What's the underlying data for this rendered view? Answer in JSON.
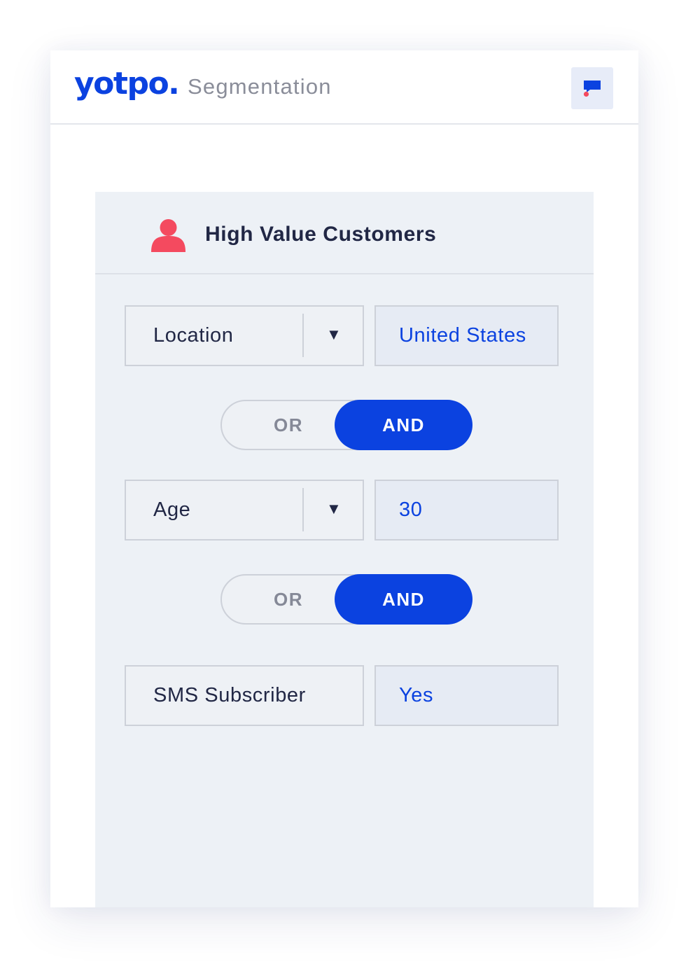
{
  "header": {
    "logo": "yotpo.",
    "title": "Segmentation",
    "chat_icon": "chat-bubble-icon"
  },
  "segment": {
    "icon": "user-icon",
    "name": "High Value Customers"
  },
  "conditions": [
    {
      "field": "Location",
      "value": "United States",
      "has_dropdown": true
    },
    {
      "field": "Age",
      "value": "30",
      "has_dropdown": true
    },
    {
      "field": "SMS Subscriber",
      "value": "Yes",
      "has_dropdown": false
    }
  ],
  "operators": [
    {
      "or_label": "OR",
      "and_label": "AND",
      "selected": "AND"
    },
    {
      "or_label": "OR",
      "and_label": "AND",
      "selected": "AND"
    }
  ],
  "dropdown_arrow": "▼",
  "colors": {
    "brand": "#0b42e0",
    "accent_red": "#f44a5f",
    "panel_bg": "#edf1f6",
    "text_dark": "#212745",
    "text_muted": "#858997"
  }
}
